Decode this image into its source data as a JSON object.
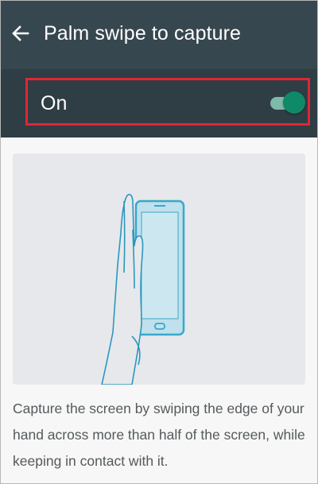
{
  "header": {
    "title": "Palm swipe to capture",
    "back_icon": "arrow-left-icon"
  },
  "setting": {
    "label": "On",
    "enabled": true,
    "toggle_colors": {
      "thumb": "#0f8a68",
      "track": "#7fb9a8"
    },
    "highlight_color": "#e02633"
  },
  "illustration": {
    "icon": "palm-swipe-phone-illustration"
  },
  "description": {
    "text": "Capture the screen by swiping the edge of your hand across more than half of the screen, while keeping in contact with it."
  }
}
